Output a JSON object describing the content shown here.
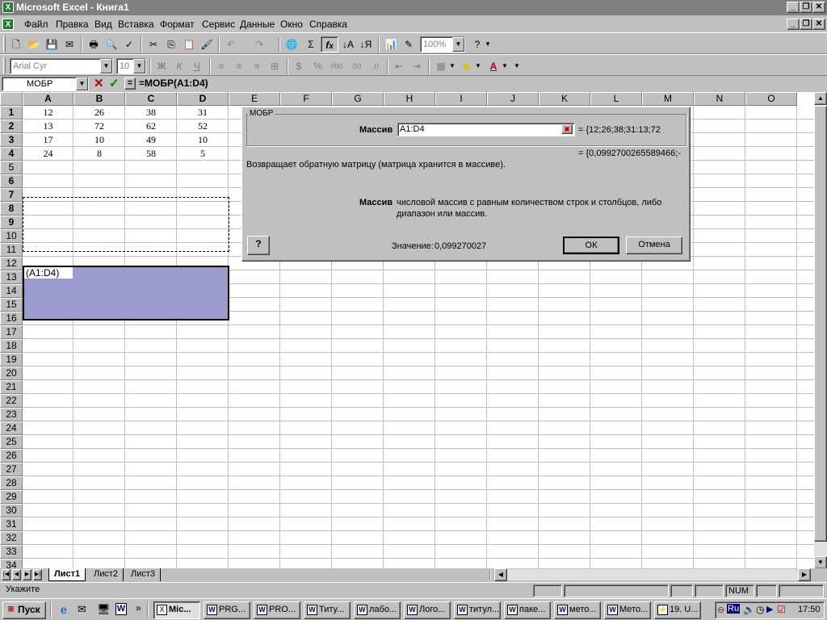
{
  "window": {
    "title": "Microsoft Excel - Книга1",
    "app_icon": "excel-icon"
  },
  "menu": [
    "Файл",
    "Правка",
    "Вид",
    "Вставка",
    "Формат",
    "Сервис",
    "Данные",
    "Окно",
    "Справка"
  ],
  "toolbar": {
    "zoom": "100%",
    "font": "Arial Cyr",
    "size": "10",
    "percent": "%",
    "thousands": "000",
    "dec_up": ",00",
    "dec_down": ",0"
  },
  "formula_bar": {
    "name_box": "МОБР",
    "formula": "=МОБР(A1:D4)"
  },
  "grid": {
    "columns": [
      "A",
      "B",
      "C",
      "D",
      "E",
      "F",
      "G",
      "H",
      "I",
      "J",
      "K",
      "L",
      "M",
      "N",
      "O"
    ],
    "rows": [
      "1",
      "2",
      "3",
      "4",
      "5",
      "6",
      "7",
      "8",
      "9",
      "10",
      "11",
      "12",
      "13",
      "14",
      "15",
      "16",
      "17",
      "18",
      "19",
      "20",
      "21",
      "22",
      "23",
      "24",
      "25",
      "26",
      "27",
      "28",
      "29",
      "30",
      "31",
      "32",
      "33",
      "34"
    ],
    "data": [
      [
        "12",
        "26",
        "38",
        "31"
      ],
      [
        "13",
        "72",
        "62",
        "52"
      ],
      [
        "17",
        "10",
        "49",
        "10"
      ],
      [
        "24",
        "8",
        "58",
        "5"
      ]
    ],
    "editing_cell": "(A1:D4)"
  },
  "dialog": {
    "group_title": "МОБР",
    "arg_label": "Массив",
    "arg_value": "A1:D4",
    "arg_preview": "= {12;26;38;31:13;72",
    "result_preview": "= {0,0992700265589466;-",
    "description": "Возвращает обратную матрицу (матрица хранится в массиве).",
    "arg_help_label": "Массив",
    "arg_help_line1": "числовой массив с равным количеством строк и столбцов, либо",
    "arg_help_line2": "диапазон или массив.",
    "value_label": "Значение:",
    "value": "0,099270027",
    "ok": "ОК",
    "cancel": "Отмена"
  },
  "sheets": [
    "Лист1",
    "Лист2",
    "Лист3"
  ],
  "status": {
    "mode": "Укажите",
    "num": "NUM"
  },
  "taskbar": {
    "start": "Пуск",
    "tasks": [
      "Mic...",
      "PRG...",
      "PRO...",
      "Титу...",
      "лабо...",
      "Лого...",
      "титул...",
      "паке...",
      "мето...",
      "Мето...",
      "19. U..."
    ],
    "lang": "Ru",
    "clock": "17:50"
  }
}
